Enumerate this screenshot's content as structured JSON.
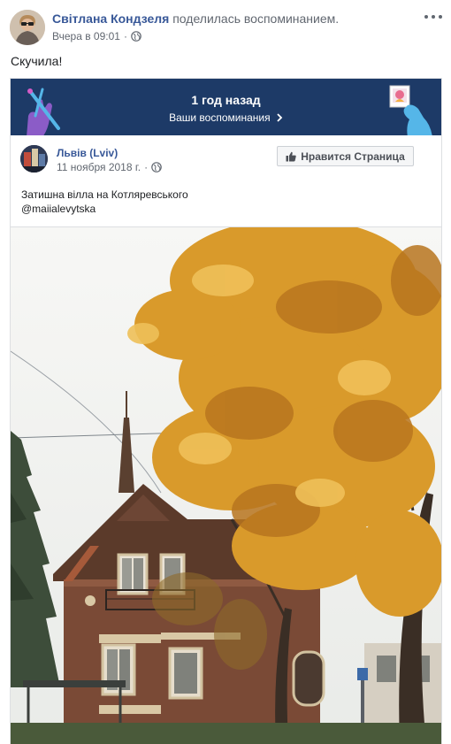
{
  "post": {
    "author": "Світлана Кондзеля",
    "action": "поделилась воспоминанием.",
    "time": "Вчера в 09:01",
    "separator": "·",
    "text": "Скучила!"
  },
  "memory": {
    "title": "1 год назад",
    "link": "Ваши воспоминания",
    "link_icon": "chevron-right-icon"
  },
  "shared_post": {
    "page_name": "Львів (Lviv)",
    "date": "11 ноября 2018 г.",
    "separator": "·",
    "like_button": "Нравится Страница",
    "caption_line1": "Затишна вілла на Котляревського",
    "caption_line2": "@maiialevytska"
  },
  "colors": {
    "banner": "#1d3a67",
    "link": "#385898",
    "autumn_leaves": "#d99a2b"
  }
}
